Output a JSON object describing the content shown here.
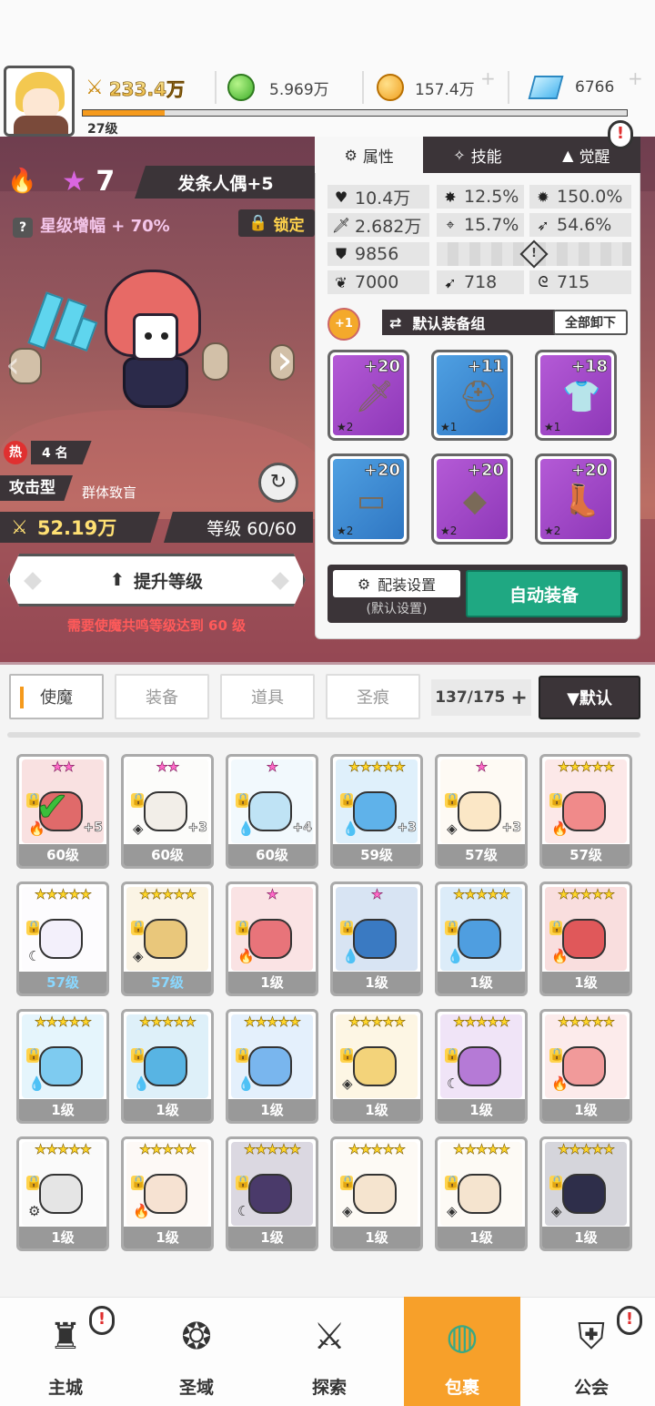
{
  "top": {
    "power": "233.4万",
    "green_gem": "5.969万",
    "gold": "157.4万",
    "diamond": "6766",
    "level": "27级",
    "xp_fraction": 0.15
  },
  "hero": {
    "star_count": "7",
    "name": "发条人偶+5",
    "star_boost": "星级增幅 + 70%",
    "lock_label": "锁定",
    "hot_rank": "4 名",
    "hot_icon": "热",
    "type": "攻击型",
    "skill_tag": "群体致盲",
    "power": "52.19万",
    "level": "等级 60/60",
    "upgrade_label": "提升等级",
    "requirement": "需要使魔共鸣等级达到 60 级"
  },
  "panel": {
    "tabs": [
      {
        "label": "属性",
        "icon": "gear-icon"
      },
      {
        "label": "技能",
        "icon": "skill-icon"
      },
      {
        "label": "觉醒",
        "icon": "awaken-icon"
      }
    ],
    "stats": {
      "hp": "10.4万",
      "crit": "12.5%",
      "crit_dmg": "150.0%",
      "atk": "2.682万",
      "acc": "15.7%",
      "speed": "54.6%",
      "def": "9856",
      "stat_a": "7000",
      "stat_b": "718",
      "stat_c": "715"
    },
    "badge": "+1",
    "equip_set": "默认装备组",
    "unequip_all": "全部卸下",
    "equipment": [
      {
        "plus": "+20",
        "stars": "★2",
        "rarity": "purple",
        "icon": "sword-icon"
      },
      {
        "plus": "+11",
        "stars": "★1",
        "rarity": "blue",
        "icon": "helmet-icon"
      },
      {
        "plus": "+18",
        "stars": "★1",
        "rarity": "purple",
        "icon": "armor-icon"
      },
      {
        "plus": "+20",
        "stars": "★2",
        "rarity": "blue",
        "icon": "belt-icon"
      },
      {
        "plus": "+20",
        "stars": "★2",
        "rarity": "purple",
        "icon": "necklace-icon"
      },
      {
        "plus": "+20",
        "stars": "★2",
        "rarity": "purple",
        "icon": "boots-icon"
      }
    ],
    "config_label": "配装设置",
    "config_sub": "(默认设置)",
    "auto_equip": "自动装备"
  },
  "filter": {
    "tabs": [
      "使魔",
      "装备",
      "道具",
      "圣痕"
    ],
    "count": "137/175",
    "sort": "▼默认"
  },
  "cards": [
    {
      "stars": "★★",
      "pink": true,
      "lvl": "60级",
      "plus": "+5",
      "elem": "🔥",
      "color": "#e06a6a",
      "checked": true
    },
    {
      "stars": "★★",
      "pink": true,
      "lvl": "60级",
      "plus": "+3",
      "elem": "◈",
      "color": "#f2eee8"
    },
    {
      "stars": "★",
      "pink": true,
      "lvl": "60级",
      "plus": "+4",
      "elem": "💧",
      "color": "#bfe3f5"
    },
    {
      "stars": "★★★★★",
      "lvl": "59级",
      "plus": "+3",
      "elem": "💧",
      "color": "#5fb2ea"
    },
    {
      "stars": "★",
      "pink": true,
      "lvl": "57级",
      "plus": "+3",
      "elem": "◈",
      "color": "#fbe7c6"
    },
    {
      "stars": "★★★★★",
      "lvl": "57级",
      "elem": "🔥",
      "color": "#f08a8a"
    },
    {
      "stars": "★★★★★",
      "lvl": "57级",
      "blue": true,
      "elem": "☾",
      "color": "#f3f0fb"
    },
    {
      "stars": "★★★★★",
      "lvl": "57级",
      "blue": true,
      "elem": "◈",
      "color": "#e9c77b"
    },
    {
      "stars": "★",
      "pink": true,
      "lvl": "1级",
      "elem": "🔥",
      "color": "#e8747a"
    },
    {
      "stars": "★",
      "pink": true,
      "lvl": "1级",
      "elem": "💧",
      "color": "#3a7ac2"
    },
    {
      "stars": "★★★★★",
      "lvl": "1级",
      "elem": "💧",
      "color": "#4f9ee0"
    },
    {
      "stars": "★★★★★",
      "lvl": "1级",
      "elem": "🔥",
      "color": "#e0585a"
    },
    {
      "stars": "★★★★★",
      "lvl": "1级",
      "elem": "💧",
      "color": "#7ecbf0"
    },
    {
      "stars": "★★★★★",
      "lvl": "1级",
      "elem": "💧",
      "color": "#58b4e3"
    },
    {
      "stars": "★★★★★",
      "lvl": "1级",
      "elem": "💧",
      "color": "#79b6ee"
    },
    {
      "stars": "★★★★★",
      "lvl": "1级",
      "elem": "◈",
      "color": "#f3d37a"
    },
    {
      "stars": "★★★★★",
      "lvl": "1级",
      "elem": "☾",
      "color": "#b57ad6"
    },
    {
      "stars": "★★★★★",
      "lvl": "1级",
      "elem": "🔥",
      "color": "#f19a9a"
    },
    {
      "stars": "★★★★★",
      "lvl": "1级",
      "elem": "⚙",
      "color": "#e5e5e5"
    },
    {
      "stars": "★★★★★",
      "lvl": "1级",
      "elem": "🔥",
      "color": "#f6e2d2"
    },
    {
      "stars": "★★★★★",
      "lvl": "1级",
      "elem": "☾",
      "color": "#4a3a6a"
    },
    {
      "stars": "★★★★★",
      "lvl": "1级",
      "elem": "◈",
      "color": "#f5e4cf"
    },
    {
      "stars": "★★★★★",
      "lvl": "1级",
      "elem": "◈",
      "color": "#f5e4cf"
    },
    {
      "stars": "★★★★★",
      "lvl": "1级",
      "elem": "◈",
      "color": "#2e2e4a"
    }
  ],
  "nav": [
    {
      "label": "主城",
      "icon": "castle-icon",
      "glyph": "♜"
    },
    {
      "label": "圣域",
      "icon": "vortex-icon",
      "glyph": "❂"
    },
    {
      "label": "探索",
      "icon": "sword-stone-icon",
      "glyph": "⚔"
    },
    {
      "label": "包裹",
      "icon": "bag-icon",
      "glyph": "◍"
    },
    {
      "label": "公会",
      "icon": "guild-icon",
      "glyph": "⛨"
    }
  ],
  "alert_mark": "!"
}
